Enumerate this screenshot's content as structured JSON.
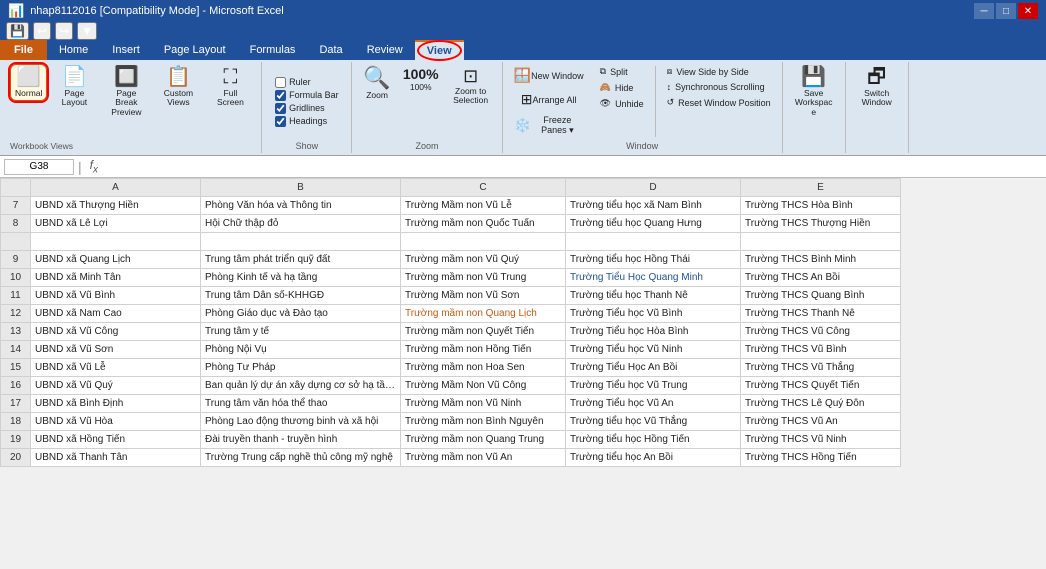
{
  "titlebar": {
    "title": "nhap8112016 [Compatibility Mode] - Microsoft Excel",
    "quickaccess": [
      "💾",
      "↩",
      "↪",
      "▼"
    ]
  },
  "ribbon": {
    "tabs": [
      "File",
      "Home",
      "Insert",
      "Page Layout",
      "Formulas",
      "Data",
      "Review",
      "View"
    ],
    "active_tab": "View",
    "groups": {
      "workbook_views": {
        "label": "Workbook Views",
        "buttons": [
          {
            "id": "normal",
            "label": "Normal",
            "icon": "⬜",
            "active": true
          },
          {
            "id": "page-layout",
            "label": "Page Layout",
            "icon": "📄"
          },
          {
            "id": "page-break",
            "label": "Page Break Preview",
            "icon": "🔲"
          },
          {
            "id": "custom-views",
            "label": "Custom Views",
            "icon": "📋"
          },
          {
            "id": "full-screen",
            "label": "Full Screen",
            "icon": "⛶"
          }
        ]
      },
      "show": {
        "label": "Show",
        "items": [
          {
            "id": "ruler",
            "label": "Ruler",
            "checked": false
          },
          {
            "id": "formula-bar",
            "label": "Formula Bar",
            "checked": true
          },
          {
            "id": "gridlines",
            "label": "Gridlines",
            "checked": true
          },
          {
            "id": "headings",
            "label": "Headings",
            "checked": true
          }
        ]
      },
      "zoom": {
        "label": "Zoom",
        "buttons": [
          {
            "id": "zoom",
            "label": "Zoom",
            "icon": "🔍"
          },
          {
            "id": "zoom100",
            "label": "100%",
            "icon": "1:1"
          },
          {
            "id": "zoom-sel",
            "label": "Zoom to Selection",
            "icon": "⊡"
          }
        ]
      },
      "window": {
        "label": "Window",
        "new_window_btn": "New Window",
        "arrange_btn": "Arrange All",
        "freeze_btn": "Freeze Panes",
        "split_btn": "Split",
        "hide_btn": "Hide",
        "unhide_btn": "Unhide",
        "side_by_side_btn": "View Side by Side",
        "sync_scroll_btn": "Synchronous Scrolling",
        "reset_btn": "Reset Window Position"
      },
      "save": {
        "label": "Save Workspace",
        "icon": "💾"
      },
      "switch": {
        "label": "Switch Window",
        "icon": "🗗"
      }
    }
  },
  "formula_bar": {
    "cell_ref": "G38",
    "formula": ""
  },
  "columns": [
    "",
    "A",
    "B",
    "C",
    "D",
    "E"
  ],
  "rows": [
    {
      "num": "7",
      "a": "UBND xã Thượng Hiền",
      "b": "Phòng Văn hóa và Thông tin",
      "c": "Trường Mầm non Vũ Lễ",
      "d": "Trường tiểu học xã Nam Bình",
      "e": "Trường THCS Hòa Bình"
    },
    {
      "num": "8",
      "a": "UBND xã Lê Lợi",
      "b": "Hội Chữ thập đỏ",
      "c": "Trường mầm non Quốc Tuấn",
      "d": "Trường tiểu học Quang Hưng",
      "e": "Trường THCS Thượng Hiền"
    },
    {
      "num": "",
      "a": "",
      "b": "",
      "c": "",
      "d": "",
      "e": ""
    },
    {
      "num": "9",
      "a": "UBND xã Quang Lịch",
      "b": "Trung tâm phát triển quỹ đất",
      "c": "Trường mầm non Vũ Quý",
      "d": "Trường tiểu học Hồng Thái",
      "e": "Trường THCS Bình Minh"
    },
    {
      "num": "10",
      "a": "UBND xã Minh Tân",
      "b": "Phòng Kinh tế và hạ tầng",
      "c": "Trường mầm non Vũ Trung",
      "d": "Trường Tiểu Học Quang Minh",
      "d_blue": true,
      "e": "Trường THCS An Bồi"
    },
    {
      "num": "11",
      "a": "UBND xã Vũ Bình",
      "b": "Trung tâm Dân số-KHHGĐ",
      "c": "Trường Mầm non Vũ Sơn",
      "d": "Trường tiểu học Thanh Nê",
      "e": "Trường THCS Quang Bình"
    },
    {
      "num": "12",
      "a": "UBND xã Nam Cao",
      "b": "Phòng Giáo dục và Đào tạo",
      "c": "Trường mầm non Quang Lịch",
      "c_blue": true,
      "d": "Trường Tiểu học Vũ Bình",
      "e": "Trường THCS Thanh Nê"
    },
    {
      "num": "13",
      "a": "UBND xã Vũ Công",
      "b": "Trung tâm y tế",
      "c": "Trường mầm non Quyết Tiến",
      "d": "Trường Tiểu học Hòa Bình",
      "e": "Trường THCS Vũ Công"
    },
    {
      "num": "14",
      "a": "UBND xã Vũ Sơn",
      "b": "Phòng Nội Vụ",
      "c": "Trường mầm non Hồng Tiến",
      "d": "Trường Tiểu học Vũ Ninh",
      "e": "Trường THCS Vũ Bình"
    },
    {
      "num": "15",
      "a": "UBND xã Vũ Lễ",
      "b": "Phòng Tư Pháp",
      "c": "Trường mầm non Hoa Sen",
      "d": "Trường Tiểu Học An Bồi",
      "e": "Trường THCS Vũ Thắng"
    },
    {
      "num": "16",
      "a": "UBND xã Vũ Quý",
      "b": "Ban quản lý dự án xây dựng cơ sở hạ tầng",
      "c": "Trường Mầm Non Vũ Công",
      "d": "Trường Tiểu học Vũ Trung",
      "e": "Trường THCS Quyết Tiến"
    },
    {
      "num": "17",
      "a": "UBND xã Bình Định",
      "b": "Trung tâm văn hóa thể thao",
      "c": "Trường Mầm non Vũ Ninh",
      "d": "Trường Tiểu học Vũ An",
      "e": "Trường THCS Lê Quý Đôn"
    },
    {
      "num": "18",
      "a": "UBND xã Vũ Hòa",
      "b": "Phòng Lao động thương binh và xã hội",
      "c": "Trường mầm non Bình Nguyên",
      "d": "Trường tiểu học Vũ Thắng",
      "e": "Trường THCS Vũ An"
    },
    {
      "num": "19",
      "a": "UBND xã Hồng Tiến",
      "b": "Đài truyền thanh - truyền hình",
      "c": "Trường mầm non Quang Trung",
      "d": "Trường tiểu học Hồng Tiến",
      "e": "Trường THCS Vũ Ninh"
    },
    {
      "num": "20",
      "a": "UBND xã Thanh Tân",
      "b": "Trường Trung cấp nghề thủ công mỹ nghệ",
      "c": "Trường mầm non Vũ An",
      "d": "Trường tiểu học An Bồi",
      "e": "Trường THCS Hồng Tiến"
    }
  ]
}
